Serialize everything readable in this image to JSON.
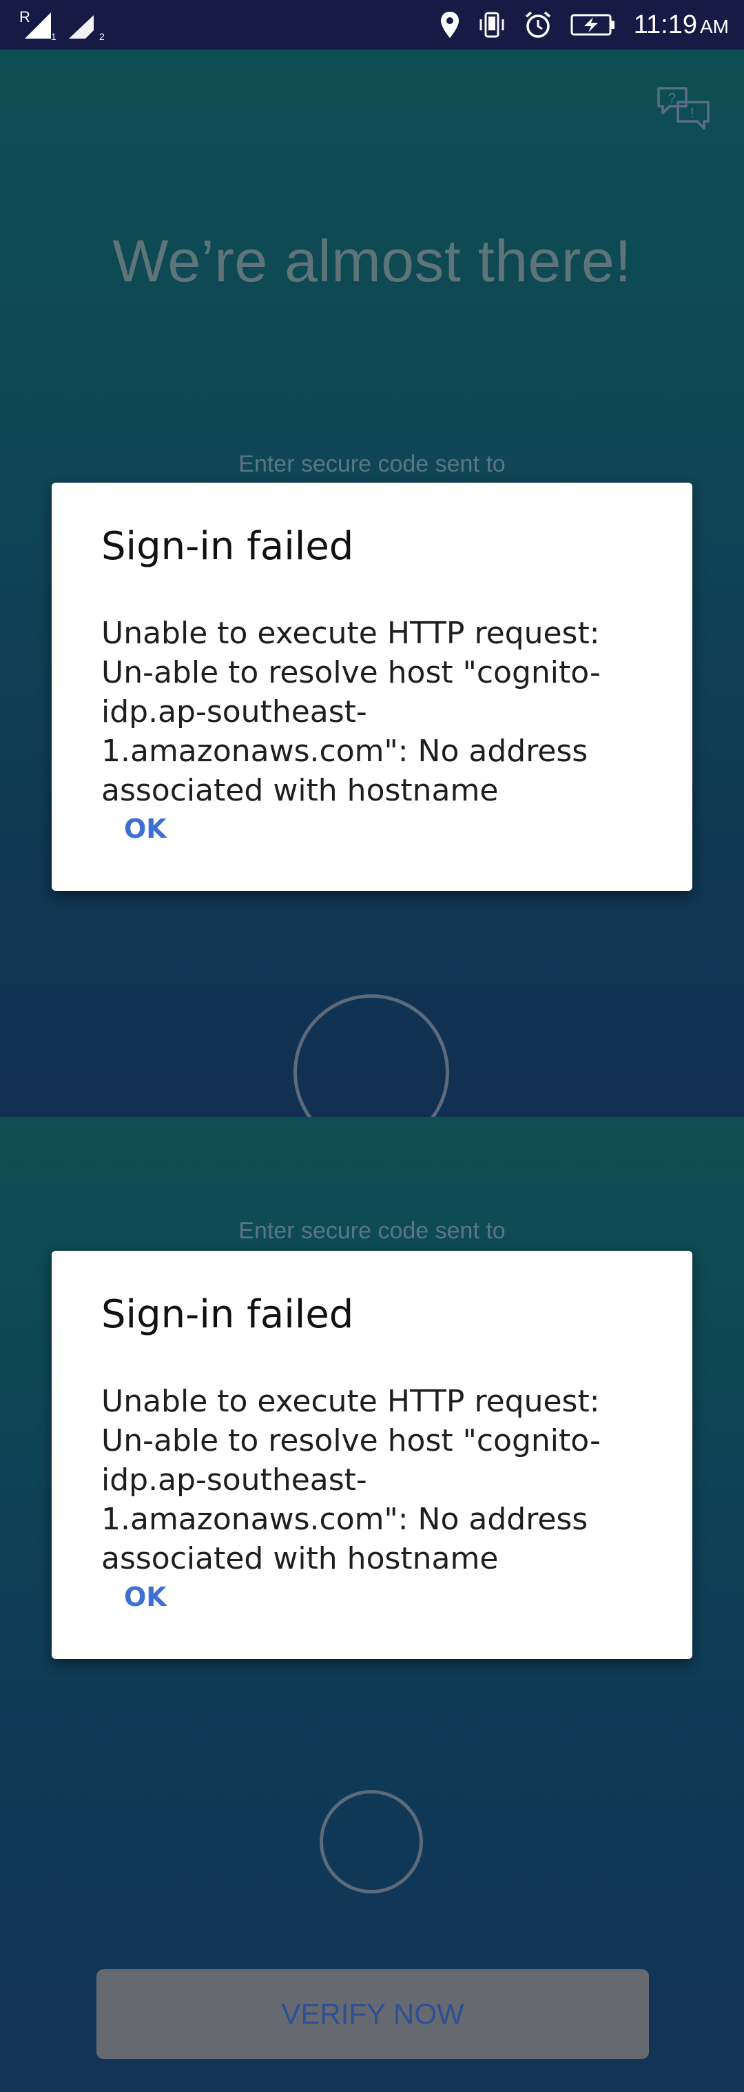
{
  "status_bar": {
    "time": "11:19",
    "ampm": "AM",
    "sim1_label": "R",
    "sim1_index": "1",
    "sim2_index": "2",
    "icons": [
      "signal-roaming-icon",
      "signal-icon",
      "location-icon",
      "vibrate-icon",
      "alarm-icon",
      "battery-charging-icon"
    ]
  },
  "top_screen": {
    "help_icon": "chat-help-icon",
    "headline": "We’re almost there!",
    "hint": "Enter secure code sent to",
    "dialog": {
      "title": "Sign-in failed",
      "message": "Unable to execute HTTP request: Un-able to resolve host \"cognito-idp.ap-southeast-1.amazonaws.com\": No address associated with hostname",
      "ok_label": "OK"
    }
  },
  "bottom_screen": {
    "hint": "Enter secure code sent to",
    "dialog": {
      "title": "Sign-in failed",
      "message": "Unable to execute HTTP request: Un-able to resolve host \"cognito-idp.ap-southeast-1.amazonaws.com\": No address associated with hostname",
      "ok_label": "OK"
    },
    "verify_label": "VERIFY NOW"
  },
  "colors": {
    "accent": "#3d6fd4",
    "status_bar": "#161a45",
    "verify_button": "#666a70"
  }
}
